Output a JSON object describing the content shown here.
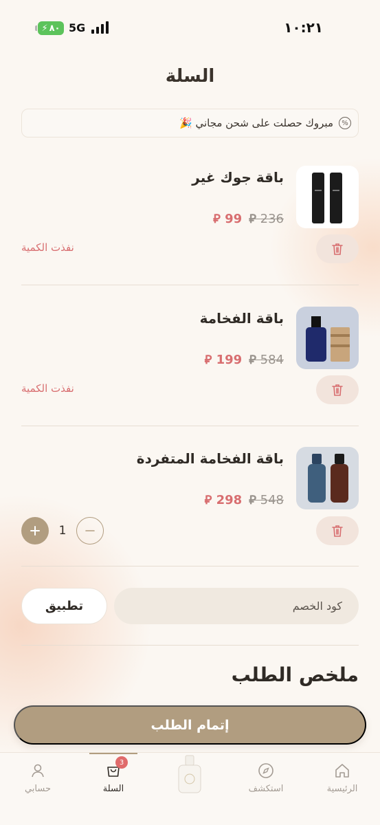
{
  "status_bar": {
    "battery": "٨٠",
    "network": "5G",
    "time": "١٠:٢١"
  },
  "header": {
    "title": "السلة"
  },
  "promo": {
    "text": "مبروك حصلت على شحن مجاني 🎉"
  },
  "cart": {
    "currency_symbol": "⃁",
    "out_of_stock_label": "نفذت الكمية",
    "items": [
      {
        "name": "باقة جوك غير",
        "old_price": "236",
        "new_price": "99",
        "status": "out_of_stock"
      },
      {
        "name": "باقة الفخامة",
        "old_price": "584",
        "new_price": "199",
        "status": "out_of_stock"
      },
      {
        "name": "باقة الفخامة المتفردة",
        "old_price": "548",
        "new_price": "298",
        "quantity": "1",
        "status": "in_stock"
      }
    ]
  },
  "coupon": {
    "placeholder": "كود الخصم",
    "apply_label": "تطبيق"
  },
  "summary": {
    "title": "ملخص الطلب"
  },
  "checkout": {
    "label": "إتمام الطلب"
  },
  "tabbar": {
    "tabs": [
      {
        "label": "الرئيسية",
        "icon": "home-icon"
      },
      {
        "label": "استكشف",
        "icon": "compass-icon"
      },
      {
        "label": "السلة",
        "icon": "cart-icon",
        "badge": "3",
        "active": true
      },
      {
        "label": "حسابي",
        "icon": "user-icon"
      }
    ]
  },
  "colors": {
    "accent": "#b19d80",
    "sale": "#d86e70",
    "background": "#fbf7f2"
  }
}
